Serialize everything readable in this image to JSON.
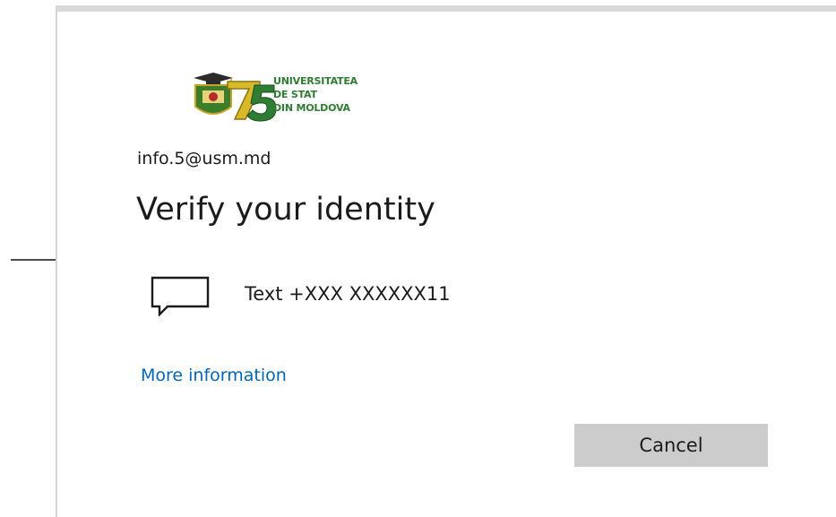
{
  "account": {
    "email": "info.5@usm.md"
  },
  "logo": {
    "number": "75",
    "lines": [
      "UNIVERSITATEA",
      "DE STAT",
      "DIN MOLDOVA"
    ]
  },
  "heading": {
    "title": "Verify your identity"
  },
  "methods": [
    {
      "icon": "chat-bubble-icon",
      "label": "Text +XXX XXXXXX11"
    }
  ],
  "links": {
    "more_info": "More information"
  },
  "buttons": {
    "cancel": "Cancel"
  },
  "colors": {
    "link": "#0067b8",
    "button_bg": "#cccccc",
    "logo_green": "#2e7d32",
    "text": "#1b1b1b"
  }
}
